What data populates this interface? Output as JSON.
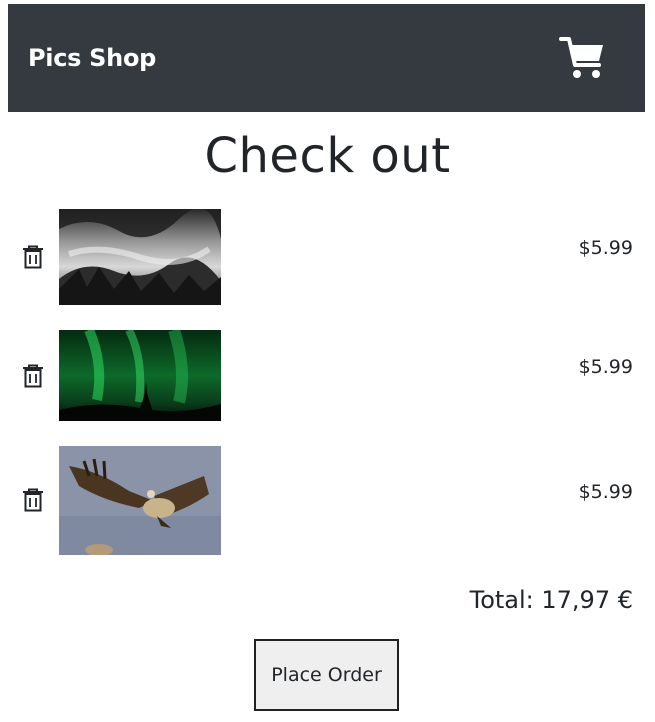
{
  "navbar": {
    "brand": "Pics Shop",
    "cart_icon": "shopping-cart-icon"
  },
  "page": {
    "title": "Check out"
  },
  "items": [
    {
      "image": "misty-forest-mountains",
      "price": "$5.99",
      "remove_icon": "trash-icon"
    },
    {
      "image": "aurora-borealis-night",
      "price": "$5.99",
      "remove_icon": "trash-icon"
    },
    {
      "image": "vulture-in-flight",
      "price": "$5.99",
      "remove_icon": "trash-icon"
    }
  ],
  "summary": {
    "total": "Total: 17,97 €"
  },
  "actions": {
    "place_order_label": "Place Order"
  },
  "colors": {
    "navbar_bg": "#343a40",
    "text": "#212529",
    "button_bg": "#efefef"
  }
}
